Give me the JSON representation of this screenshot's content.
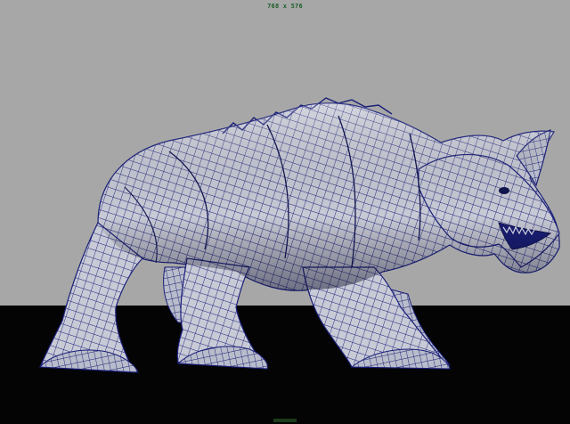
{
  "viewport": {
    "resolution_label": "768 x 576",
    "background_color": "#a7a7a7",
    "ground_color": "#040404",
    "wireframe_color": "#1a1f78",
    "surface_color": "#c4c6d2"
  },
  "scene": {
    "object_icon": "rhino-creature-wireframe-model"
  }
}
